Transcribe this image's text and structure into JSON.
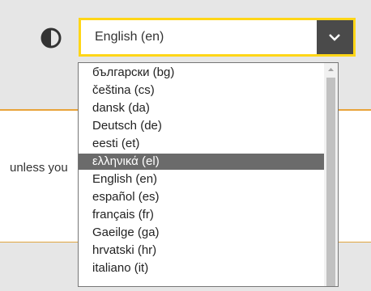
{
  "header": {
    "contrast_icon": "contrast-icon",
    "language_select": {
      "value": "English (en)",
      "button_icon": "chevron-down-icon"
    }
  },
  "main": {
    "panel_text": "unless you"
  },
  "dropdown": {
    "options": [
      {
        "label": "български (bg)"
      },
      {
        "label": "čeština (cs)"
      },
      {
        "label": "dansk (da)"
      },
      {
        "label": "Deutsch (de)"
      },
      {
        "label": "eesti (et)"
      },
      {
        "label": "ελληνικά (el)"
      },
      {
        "label": "English (en)"
      },
      {
        "label": "español (es)"
      },
      {
        "label": "français (fr)"
      },
      {
        "label": "Gaeilge (ga)"
      },
      {
        "label": "hrvatski (hr)"
      },
      {
        "label": "italiano (it)"
      }
    ],
    "highlighted": "ελληνικά (el)",
    "highlight_color": "#6b6b6b"
  },
  "colors": {
    "select_border": "#ffd617",
    "panel_border": "#e8a33a",
    "select_button": "#4a4a4a"
  }
}
